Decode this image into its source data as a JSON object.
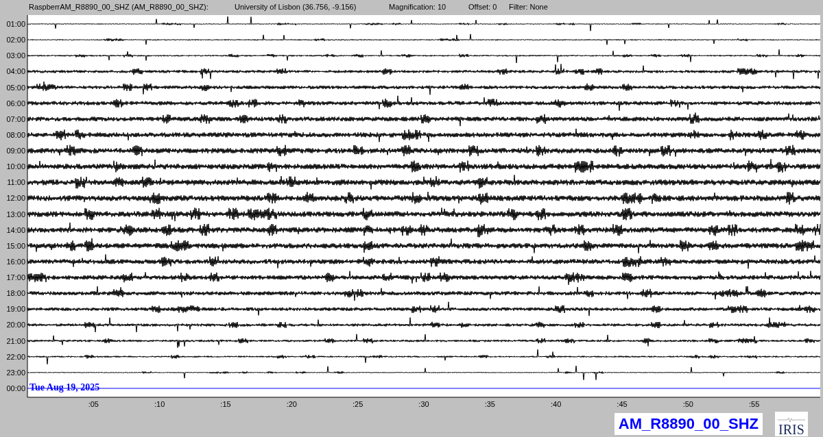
{
  "header": {
    "station": "RaspberrAM_R8890_00_SHZ (AM_R8890_00_SHZ):",
    "location": "University of Lisbon (36.756, -9.156)",
    "magnification": "Magnification: 10",
    "offset": "Offset: 0",
    "filter": "Filter: None"
  },
  "rows": [
    {
      "time": "01:00",
      "kind": "trace"
    },
    {
      "time": "02:00",
      "kind": "trace"
    },
    {
      "time": "03:00",
      "kind": "trace"
    },
    {
      "time": "04:00",
      "kind": "trace"
    },
    {
      "time": "05:00",
      "kind": "trace"
    },
    {
      "time": "06:00",
      "kind": "trace"
    },
    {
      "time": "07:00",
      "kind": "trace"
    },
    {
      "time": "08:00",
      "kind": "trace"
    },
    {
      "time": "09:00",
      "kind": "trace"
    },
    {
      "time": "10:00",
      "kind": "trace"
    },
    {
      "time": "11:00",
      "kind": "trace"
    },
    {
      "time": "12:00",
      "kind": "trace"
    },
    {
      "time": "13:00",
      "kind": "trace"
    },
    {
      "time": "14:00",
      "kind": "trace"
    },
    {
      "time": "15:00",
      "kind": "trace"
    },
    {
      "time": "16:00",
      "kind": "trace"
    },
    {
      "time": "17:00",
      "kind": "trace"
    },
    {
      "time": "18:00",
      "kind": "trace"
    },
    {
      "time": "19:00",
      "kind": "trace"
    },
    {
      "time": "20:00",
      "kind": "trace"
    },
    {
      "time": "21:00",
      "kind": "trace"
    },
    {
      "time": "22:00",
      "kind": "trace"
    },
    {
      "time": "23:00",
      "kind": "trace"
    },
    {
      "time": "00:00",
      "kind": "current"
    }
  ],
  "date": "Tue Aug 19, 2025",
  "minute_ticks": [
    ":05",
    ":10",
    ":15",
    ":20",
    ":25",
    ":30",
    ":35",
    ":40",
    ":45",
    ":50",
    ":55"
  ],
  "station_code": "AM_R8890_00_SHZ",
  "logo": "IRIS"
}
